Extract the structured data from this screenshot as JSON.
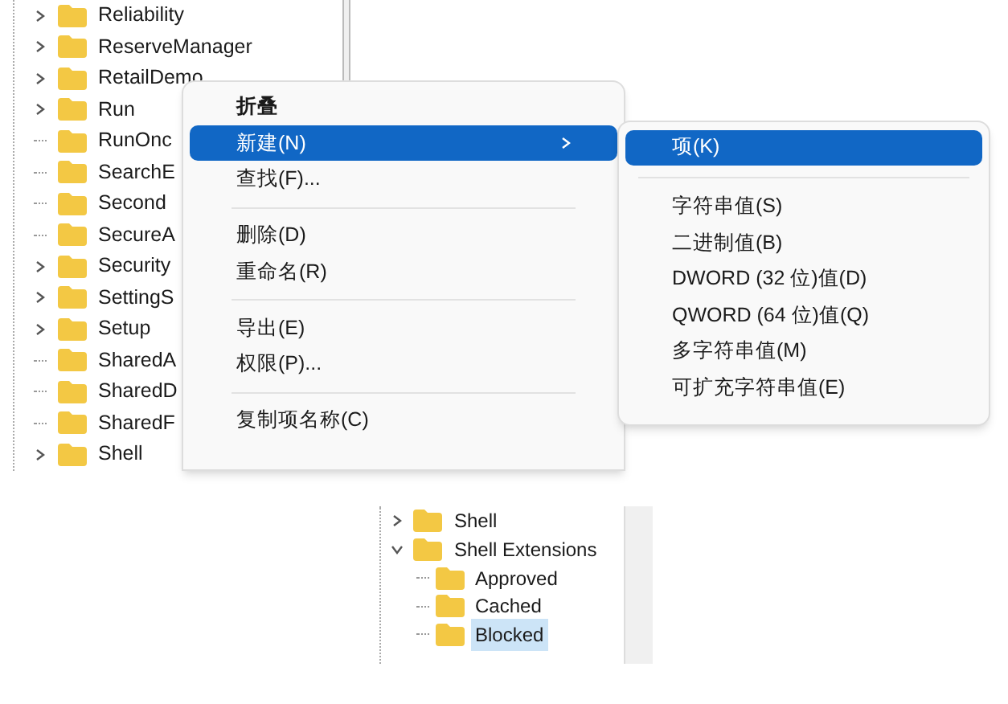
{
  "tree": {
    "items": [
      {
        "label": "Reliability",
        "expandable": true
      },
      {
        "label": "ReserveManager",
        "expandable": true
      },
      {
        "label": "RetailDemo",
        "expandable": true
      },
      {
        "label": "Run",
        "expandable": true
      },
      {
        "label": "RunOnc",
        "expandable": false
      },
      {
        "label": "SearchE",
        "expandable": false
      },
      {
        "label": "Second",
        "expandable": false
      },
      {
        "label": "SecureA",
        "expandable": false
      },
      {
        "label": "Security",
        "expandable": true
      },
      {
        "label": "SettingS",
        "expandable": true
      },
      {
        "label": "Setup",
        "expandable": true
      },
      {
        "label": "SharedA",
        "expandable": false
      },
      {
        "label": "SharedD",
        "expandable": false
      },
      {
        "label": "SharedF",
        "expandable": false
      },
      {
        "label": "Shell",
        "expandable": true
      }
    ]
  },
  "context_menu": {
    "items": [
      {
        "kind": "default",
        "label": "折叠",
        "selected": false,
        "submenu": false
      },
      {
        "kind": "item",
        "label": "新建(N)",
        "selected": true,
        "submenu": true
      },
      {
        "kind": "item",
        "label": "查找(F)...",
        "selected": false,
        "submenu": false
      },
      {
        "kind": "separator"
      },
      {
        "kind": "item",
        "label": "删除(D)",
        "selected": false,
        "submenu": false
      },
      {
        "kind": "item",
        "label": "重命名(R)",
        "selected": false,
        "submenu": false
      },
      {
        "kind": "separator"
      },
      {
        "kind": "item",
        "label": "导出(E)",
        "selected": false,
        "submenu": false
      },
      {
        "kind": "item",
        "label": "权限(P)...",
        "selected": false,
        "submenu": false
      },
      {
        "kind": "separator"
      },
      {
        "kind": "item",
        "label": "复制项名称(C)",
        "selected": false,
        "submenu": false
      }
    ]
  },
  "submenu": {
    "items": [
      {
        "kind": "item",
        "label": "项(K)",
        "selected": true
      },
      {
        "kind": "separator"
      },
      {
        "kind": "item",
        "label": "字符串值(S)",
        "selected": false
      },
      {
        "kind": "item",
        "label": "二进制值(B)",
        "selected": false
      },
      {
        "kind": "item",
        "label": "DWORD (32 位)值(D)",
        "selected": false
      },
      {
        "kind": "item",
        "label": "QWORD (64 位)值(Q)",
        "selected": false
      },
      {
        "kind": "item",
        "label": "多字符串值(M)",
        "selected": false
      },
      {
        "kind": "item",
        "label": "可扩充字符串值(E)",
        "selected": false
      }
    ]
  },
  "detail_tree": {
    "items": [
      {
        "label": "Shell",
        "expanded": false,
        "selected": false
      },
      {
        "label": "Shell Extensions",
        "expanded": true,
        "selected": false,
        "children": [
          {
            "label": "Approved",
            "selected": false
          },
          {
            "label": "Cached",
            "selected": false
          },
          {
            "label": "Blocked",
            "selected": true
          }
        ]
      }
    ]
  }
}
